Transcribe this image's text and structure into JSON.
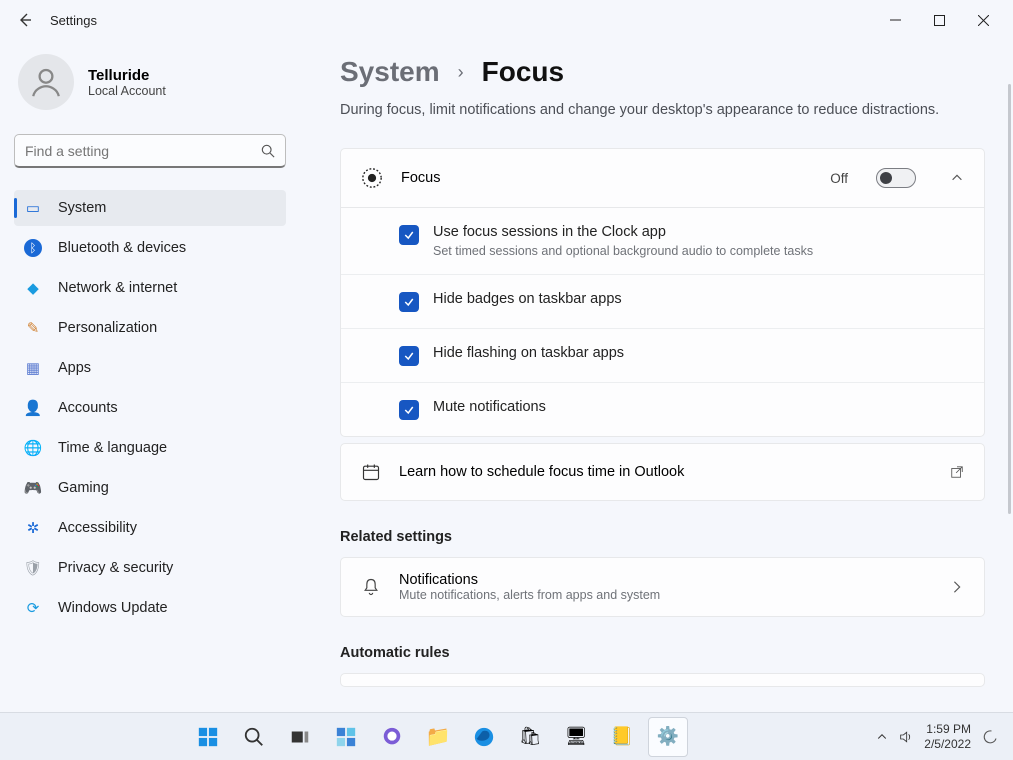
{
  "app": {
    "title": "Settings"
  },
  "account": {
    "name": "Telluride",
    "type": "Local Account"
  },
  "search": {
    "placeholder": "Find a setting"
  },
  "nav": [
    {
      "label": "System",
      "icon": "💻",
      "color": "#1a69d6"
    },
    {
      "label": "Bluetooth & devices",
      "icon": "ᛒ",
      "color": "#1a69d6"
    },
    {
      "label": "Network & internet",
      "icon": "◆",
      "color": "#1a9be0"
    },
    {
      "label": "Personalization",
      "icon": "🖌",
      "color": "#d08030"
    },
    {
      "label": "Apps",
      "icon": "▦",
      "color": "#5a7ad0"
    },
    {
      "label": "Accounts",
      "icon": "👤",
      "color": "#2fa84f"
    },
    {
      "label": "Time & language",
      "icon": "🌐",
      "color": "#3fa8d0"
    },
    {
      "label": "Gaming",
      "icon": "🎮",
      "color": "#808590"
    },
    {
      "label": "Accessibility",
      "icon": "✲",
      "color": "#1a69d6"
    },
    {
      "label": "Privacy & security",
      "icon": "🛡",
      "color": "#9aa0a8"
    },
    {
      "label": "Windows Update",
      "icon": "🔄",
      "color": "#1a9be0"
    }
  ],
  "breadcrumb": {
    "parent": "System",
    "current": "Focus"
  },
  "subtitle": "During focus, limit notifications and change your desktop's appearance to reduce distractions.",
  "focus": {
    "title": "Focus",
    "state_label": "Off",
    "options": [
      {
        "label": "Use focus sessions in the Clock app",
        "desc": "Set timed sessions and optional background audio to complete tasks",
        "checked": true
      },
      {
        "label": "Hide badges on taskbar apps",
        "checked": true
      },
      {
        "label": "Hide flashing on taskbar apps",
        "checked": true
      },
      {
        "label": "Mute notifications",
        "checked": true
      }
    ]
  },
  "outlook_link": "Learn how to schedule focus time in Outlook",
  "related": {
    "heading": "Related settings",
    "item": {
      "title": "Notifications",
      "desc": "Mute notifications, alerts from apps and system"
    }
  },
  "automatic": {
    "heading": "Automatic rules"
  },
  "taskbar": {
    "time": "1:59 PM",
    "date": "2/5/2022"
  }
}
